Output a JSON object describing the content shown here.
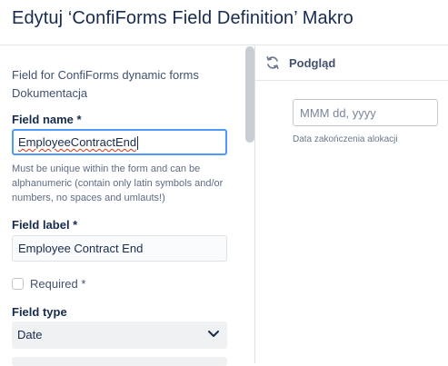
{
  "dialog": {
    "title": "Edytuj ‘ConfiForms Field Definition’ Makro"
  },
  "form": {
    "description_line": "Field for ConfiForms dynamic forms",
    "documentation_link": "Dokumentacja",
    "field_name": {
      "label": "Field name *",
      "value": "EmployeeContractEnd",
      "help": "Must be unique within the form and can be alphanumeric (contain only latin symbols and/or numbers, no spaces and umlauts!)"
    },
    "field_label": {
      "label": "Field label *",
      "value": "Employee Contract End"
    },
    "required": {
      "label": "Required *",
      "checked": false
    },
    "field_type": {
      "label": "Field type",
      "selected": "Date"
    }
  },
  "preview": {
    "header_label": "Podgląd",
    "refresh_icon": "refresh-icon",
    "date_placeholder": "MMM dd, yyyy",
    "date_caption": "Data zakończenia alokacji"
  },
  "colors": {
    "focus_border": "#4c9aff",
    "text_primary": "#172b4d",
    "spellcheck": "#de350b",
    "select_bg": "#f0f1f3"
  }
}
